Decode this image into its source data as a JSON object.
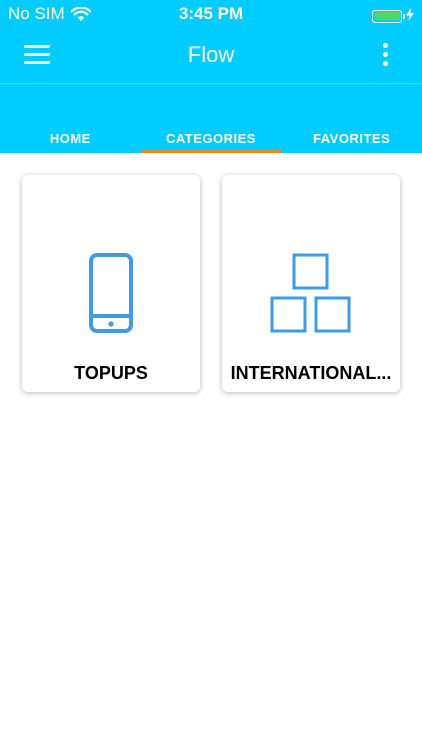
{
  "status_bar": {
    "carrier": "No SIM",
    "time": "3:45 PM",
    "battery_level": 1.0,
    "battery_color": "#4cd964"
  },
  "nav": {
    "title": "Flow",
    "menu_icon": "hamburger-menu-icon",
    "more_icon": "more-vertical-icon"
  },
  "tabs": [
    {
      "label": "HOME",
      "active": false
    },
    {
      "label": "CATEGORIES",
      "active": true
    },
    {
      "label": "FAVORITES",
      "active": false
    }
  ],
  "categories": [
    {
      "label": "TOPUPS",
      "icon": "mobile-phone-icon"
    },
    {
      "label": "INTERNATIONAL...",
      "icon": "stacked-boxes-icon"
    }
  ],
  "colors": {
    "primary": "#00ccff",
    "tab_indicator": "#f5841f",
    "icon": "#3d9be9"
  }
}
